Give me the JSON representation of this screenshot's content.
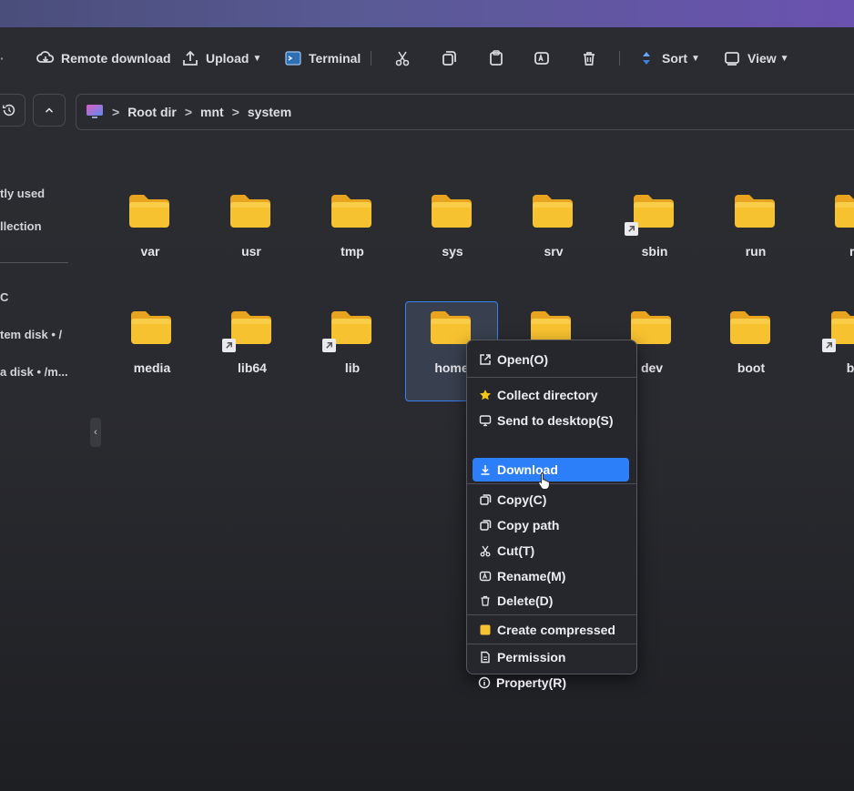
{
  "toolbar": {
    "remote_download": "Remote download",
    "upload": "Upload",
    "terminal": "Terminal",
    "sort": "Sort",
    "view": "View",
    "icons": [
      "cut-icon",
      "copy-icon",
      "paste-icon",
      "rename-icon",
      "delete-icon"
    ]
  },
  "path": {
    "root": "Root dir",
    "segments": [
      "mnt",
      "system"
    ]
  },
  "sidebar": {
    "recently_used": "tly used",
    "collection": "llection",
    "pc": "C",
    "system_disk": "tem disk • /",
    "data_disk": "a disk • /m..."
  },
  "files": {
    "row1": [
      "var",
      "usr",
      "tmp",
      "sys",
      "srv",
      "sbin",
      "run",
      "ro"
    ],
    "row2": [
      "media",
      "lib64",
      "lib",
      "home",
      "",
      "dev",
      "boot",
      "bi"
    ]
  },
  "menu": {
    "open": "Open(O)",
    "collect": "Collect directory",
    "send_desktop": "Send to desktop(S)",
    "download": "Download",
    "copy": "Copy(C)",
    "copy_path": "Copy path",
    "cut": "Cut(T)",
    "rename": "Rename(M)",
    "delete": "Delete(D)",
    "create_compressed": "Create compressed",
    "permission": "Permission",
    "property": "Property(R)"
  },
  "colors": {
    "accent": "#2d7ff9",
    "folder": "#f7c230",
    "star": "#f5c518"
  }
}
